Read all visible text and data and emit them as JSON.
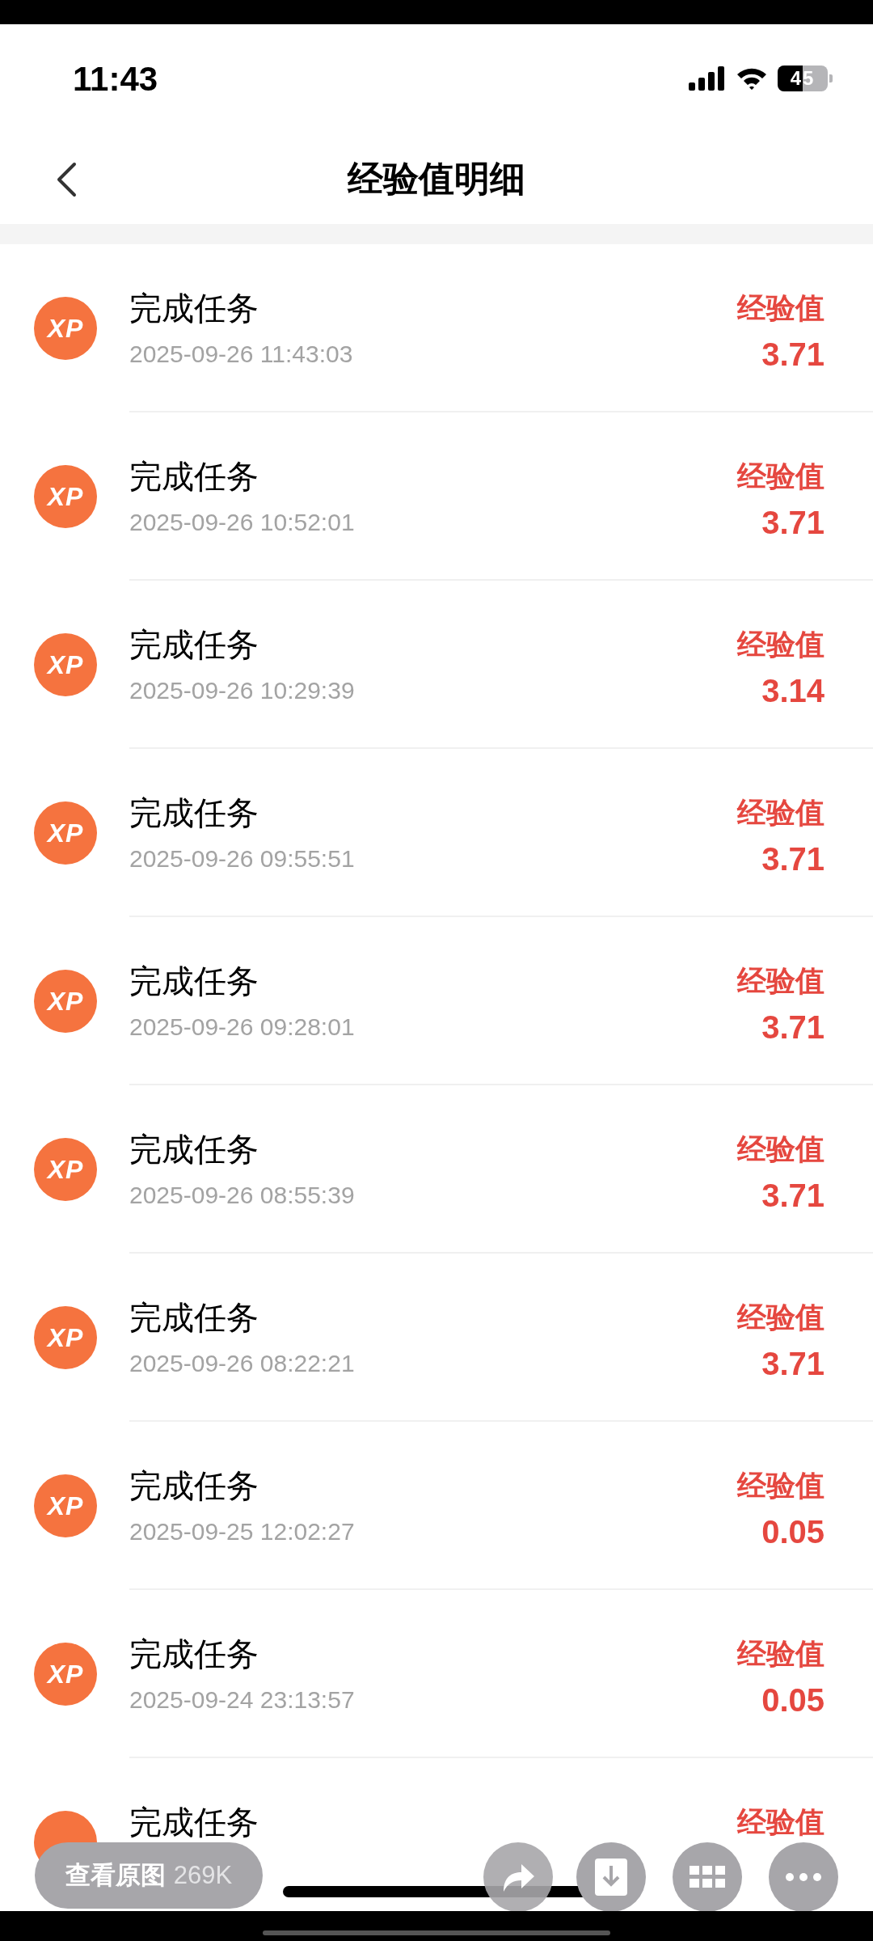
{
  "status_bar": {
    "time": "11:43",
    "battery": "45"
  },
  "header": {
    "title": "经验值明细"
  },
  "records": [
    {
      "badge": "XP",
      "title": "完成任务",
      "time": "2025-09-26 11:43:03",
      "label": "经验值",
      "value": "3.71"
    },
    {
      "badge": "XP",
      "title": "完成任务",
      "time": "2025-09-26 10:52:01",
      "label": "经验值",
      "value": "3.71"
    },
    {
      "badge": "XP",
      "title": "完成任务",
      "time": "2025-09-26 10:29:39",
      "label": "经验值",
      "value": "3.14"
    },
    {
      "badge": "XP",
      "title": "完成任务",
      "time": "2025-09-26 09:55:51",
      "label": "经验值",
      "value": "3.71"
    },
    {
      "badge": "XP",
      "title": "完成任务",
      "time": "2025-09-26 09:28:01",
      "label": "经验值",
      "value": "3.71"
    },
    {
      "badge": "XP",
      "title": "完成任务",
      "time": "2025-09-26 08:55:39",
      "label": "经验值",
      "value": "3.71"
    },
    {
      "badge": "XP",
      "title": "完成任务",
      "time": "2025-09-26 08:22:21",
      "label": "经验值",
      "value": "3.71"
    },
    {
      "badge": "XP",
      "title": "完成任务",
      "time": "2025-09-25 12:02:27",
      "label": "经验值",
      "value": "0.05"
    },
    {
      "badge": "XP",
      "title": "完成任务",
      "time": "2025-09-24 23:13:57",
      "label": "经验值",
      "value": "0.05"
    },
    {
      "title": "完成任务",
      "label": "经验值"
    }
  ],
  "viewer_bar": {
    "original_button": {
      "label": "查看原图",
      "size": "269K"
    }
  }
}
